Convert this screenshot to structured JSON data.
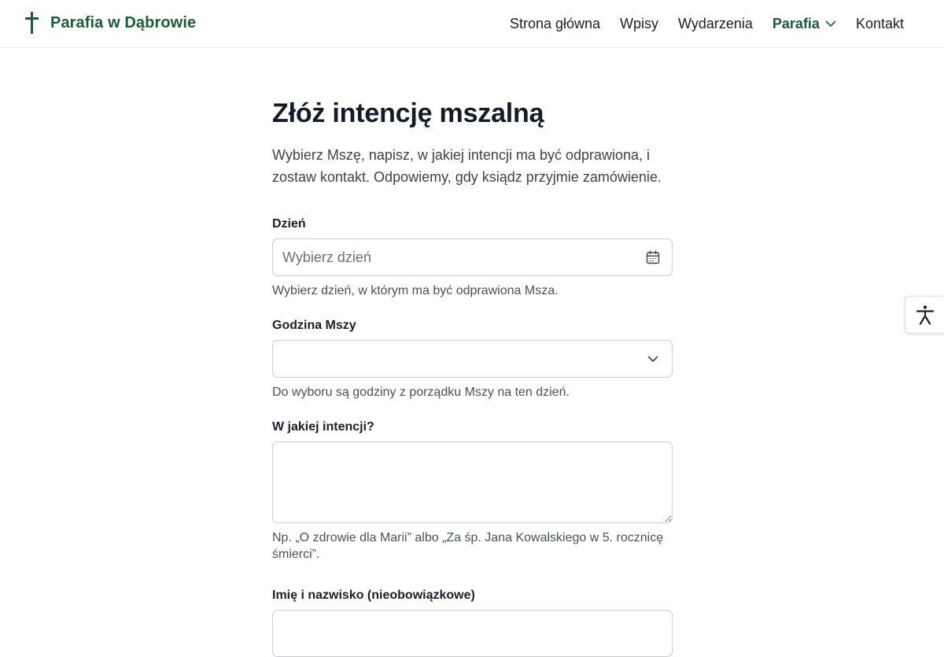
{
  "header": {
    "brand_name": "Parafia w Dąbrowie",
    "brand_icon": "cross-icon",
    "brand_color": "#1e5b3a",
    "nav": [
      {
        "label": "Strona główna",
        "active": false
      },
      {
        "label": "Wpisy",
        "active": false
      },
      {
        "label": "Wydarzenia",
        "active": false
      },
      {
        "label": "Parafia",
        "active": true,
        "has_dropdown": true
      },
      {
        "label": "Kontakt",
        "active": false
      }
    ]
  },
  "accessibility": {
    "icon": "accessibility-person-icon"
  },
  "form": {
    "title": "Złóż intencję mszalną",
    "lead": "Wybierz Mszę, napisz, w jakiej intencji ma być odprawiona, i zostaw kontakt. Odpowiemy, gdy ksiądz przyjmie zamówienie.",
    "day": {
      "label": "Dzień",
      "placeholder": "Wybierz dzień",
      "value": "",
      "hint": "Wybierz dzień, w którym ma być odprawiona Msza.",
      "icon": "calendar-icon"
    },
    "hour": {
      "label": "Godzina Mszy",
      "selected": "",
      "hint": "Do wyboru są godziny z porządku Mszy na ten dzień.",
      "icon": "chevron-down-icon"
    },
    "intention": {
      "label": "W jakiej intencji?",
      "value": "",
      "hint": "Np. „O zdrowie dla Marii” albo „Za śp. Jana Kowalskiego w 5. rocznicę śmierci”."
    },
    "name": {
      "label": "Imię i nazwisko (nieobowiązkowe)",
      "value": ""
    }
  }
}
